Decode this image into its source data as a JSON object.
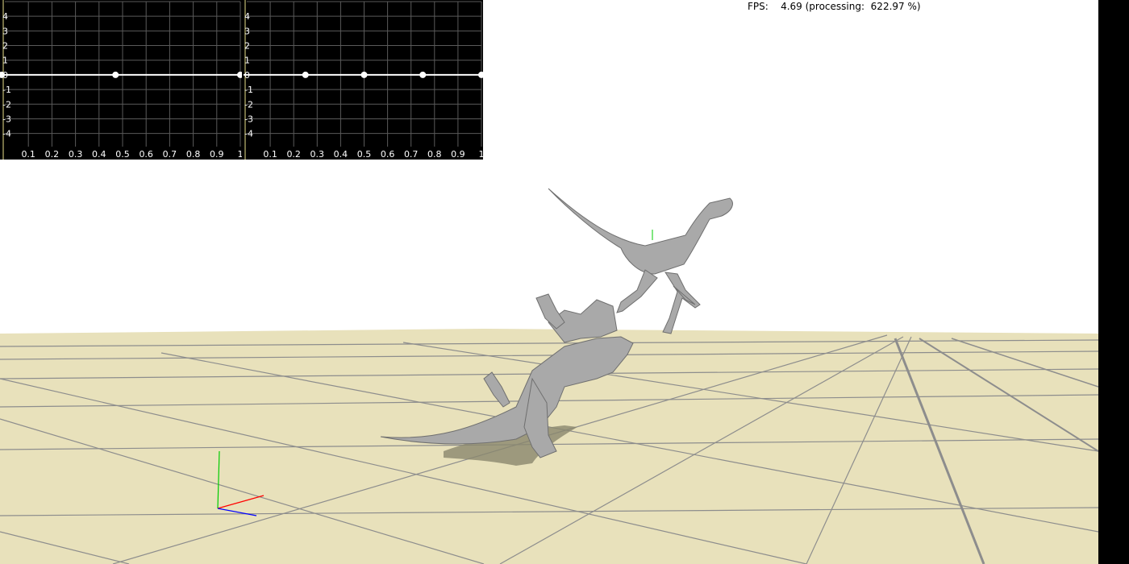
{
  "status": {
    "fps_label": "FPS:",
    "fps_value": "4.69",
    "processing_label": "(processing:",
    "processing_value": "622.97 %)"
  },
  "plots": [
    {
      "y_ticks": [
        "4",
        "3",
        "2",
        "1",
        "0",
        "-1",
        "-2",
        "-3",
        "-4"
      ],
      "x_ticks": [
        "0.1",
        "0.2",
        "0.3",
        "0.4",
        "0.5",
        "0.6",
        "0.7",
        "0.8",
        "0.9",
        "1"
      ],
      "line_value": 0,
      "markers_x": [
        0.0,
        0.47,
        1.0
      ]
    },
    {
      "y_ticks": [
        "4",
        "3",
        "2",
        "1",
        "0",
        "-1",
        "-2",
        "-3",
        "-4"
      ],
      "x_ticks": [
        "0.1",
        "0.2",
        "0.3",
        "0.4",
        "0.5",
        "0.6",
        "0.7",
        "0.8",
        "0.9",
        "1"
      ],
      "line_value": 0,
      "markers_x": [
        0.25,
        0.5,
        0.75,
        1.0
      ]
    }
  ],
  "colors": {
    "ground": "#e8e1bb",
    "grid_line": "#8d8d8d",
    "plot_bg": "#000000",
    "plot_grid": "#5a5a5a",
    "plot_axis": "#e8e18a",
    "creature": "#a9a9a9",
    "shadow": "#8a876e",
    "axis_x": "#ff0000",
    "axis_y": "#00cc00",
    "axis_z": "#0000ff"
  },
  "scene": {
    "creatures": [
      "raptor-standing",
      "raptor-fallen"
    ]
  }
}
